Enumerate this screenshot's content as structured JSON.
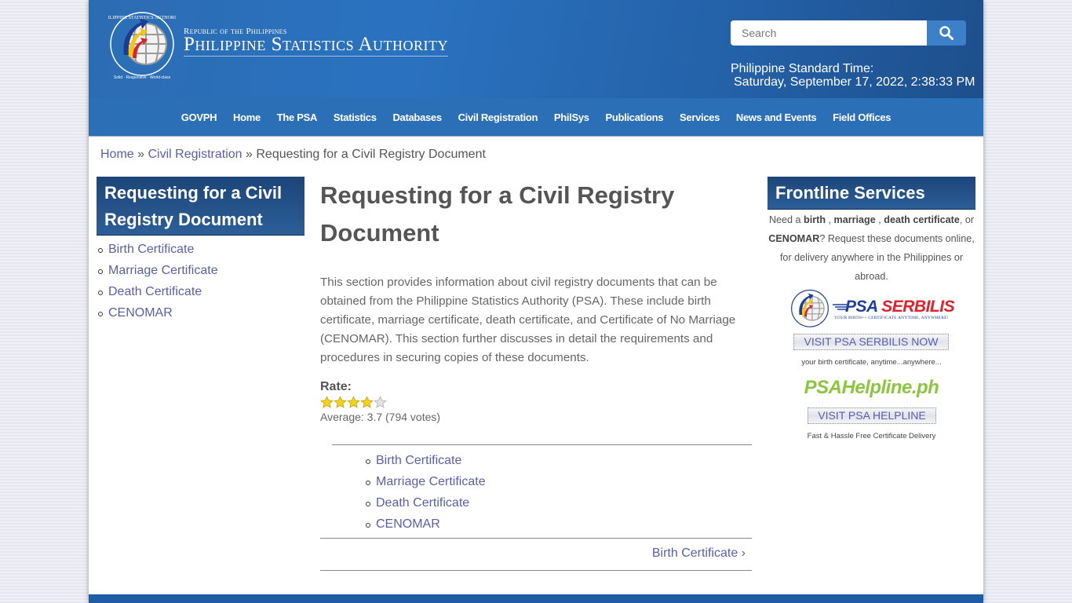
{
  "header": {
    "republic": "Republic of the Philippines",
    "agency": "Philippine Statistics Authority",
    "seal_name": "psa-seal-icon",
    "search": {
      "placeholder": "Search",
      "value": "",
      "button_icon": "search-icon"
    },
    "pst_label": "Philippine Standard Time:",
    "pst_value": "Saturday, September 17, 2022, 2:38:33 PM"
  },
  "nav": {
    "items": [
      {
        "label": "GOVPH"
      },
      {
        "label": "Home"
      },
      {
        "label": "The PSA"
      },
      {
        "label": "Statistics"
      },
      {
        "label": "Databases"
      },
      {
        "label": "Civil Registration"
      },
      {
        "label": "PhilSys"
      },
      {
        "label": "Publications"
      },
      {
        "label": "Services"
      },
      {
        "label": "News and Events"
      },
      {
        "label": "Field Offices"
      }
    ]
  },
  "breadcrumb": {
    "items": [
      {
        "label": "Home"
      },
      {
        "label": "Civil Registration"
      }
    ],
    "separator": "»",
    "current": "Requesting for a Civil Registry Document"
  },
  "left_sidebar": {
    "title": "Requesting for a Civil Registry Document",
    "items": [
      {
        "label": "Birth Certificate"
      },
      {
        "label": "Marriage Certificate"
      },
      {
        "label": "Death Certificate"
      },
      {
        "label": "CENOMAR"
      }
    ]
  },
  "main": {
    "title": "Requesting for a Civil Registry Document",
    "intro": "This section provides information about civil registry documents that can be obtained from the Philippine Statistics Authority (PSA). These include birth certificate, marriage certificate, death certificate, and Certificate of No Marriage (CENOMAR). This section further discusses in detail the requirements and procedures in securing copies of these documents.",
    "rating": {
      "label": "Rate:",
      "stars_total": 5,
      "stars_filled": 4,
      "average_text": "Average: 3.7 (794 votes)",
      "average": 3.7,
      "votes": 794
    },
    "book_nav": {
      "items": [
        {
          "label": "Birth Certificate"
        },
        {
          "label": "Marriage Certificate"
        },
        {
          "label": "Death Certificate"
        },
        {
          "label": "CENOMAR"
        }
      ],
      "next_label": "Birth Certificate ›"
    }
  },
  "right_sidebar": {
    "title": "Frontline Services",
    "text": {
      "p1": "Need a ",
      "b1": "birth",
      "p2": " , ",
      "b2": "marriage",
      "p3": " , ",
      "b3": "death certificate",
      "p4": ", or ",
      "b4": "CENOMAR",
      "p5": "? Request these documents online, for delivery anywhere in the Philippines or abroad."
    },
    "serbilis": {
      "word_psa": "PSA",
      "word_serbilis": "SERBILIS",
      "tagline": "YOUR BIRTH++ CERTIFICATE ANYTIME, ANYWHERE!",
      "button": "VISIT PSA SERBILIS NOW",
      "caption": "your birth certificate, anytime...anywhere..."
    },
    "helpline": {
      "logo": "PSAHelpline.ph",
      "button": "VISIT PSA HELPLINE",
      "caption": "Fast & Hassle Free Certificate Delivery"
    }
  },
  "colors": {
    "header_blue": "#2a72c0",
    "nav_blue": "#2b6fb7",
    "box_navy": "#1c4578",
    "link": "#5a5fa8",
    "helpline_green": "#8cc63f",
    "serbilis_red": "#e0202a",
    "serbilis_blue": "#1f3f9c",
    "star_gold": "#f5d21c"
  }
}
